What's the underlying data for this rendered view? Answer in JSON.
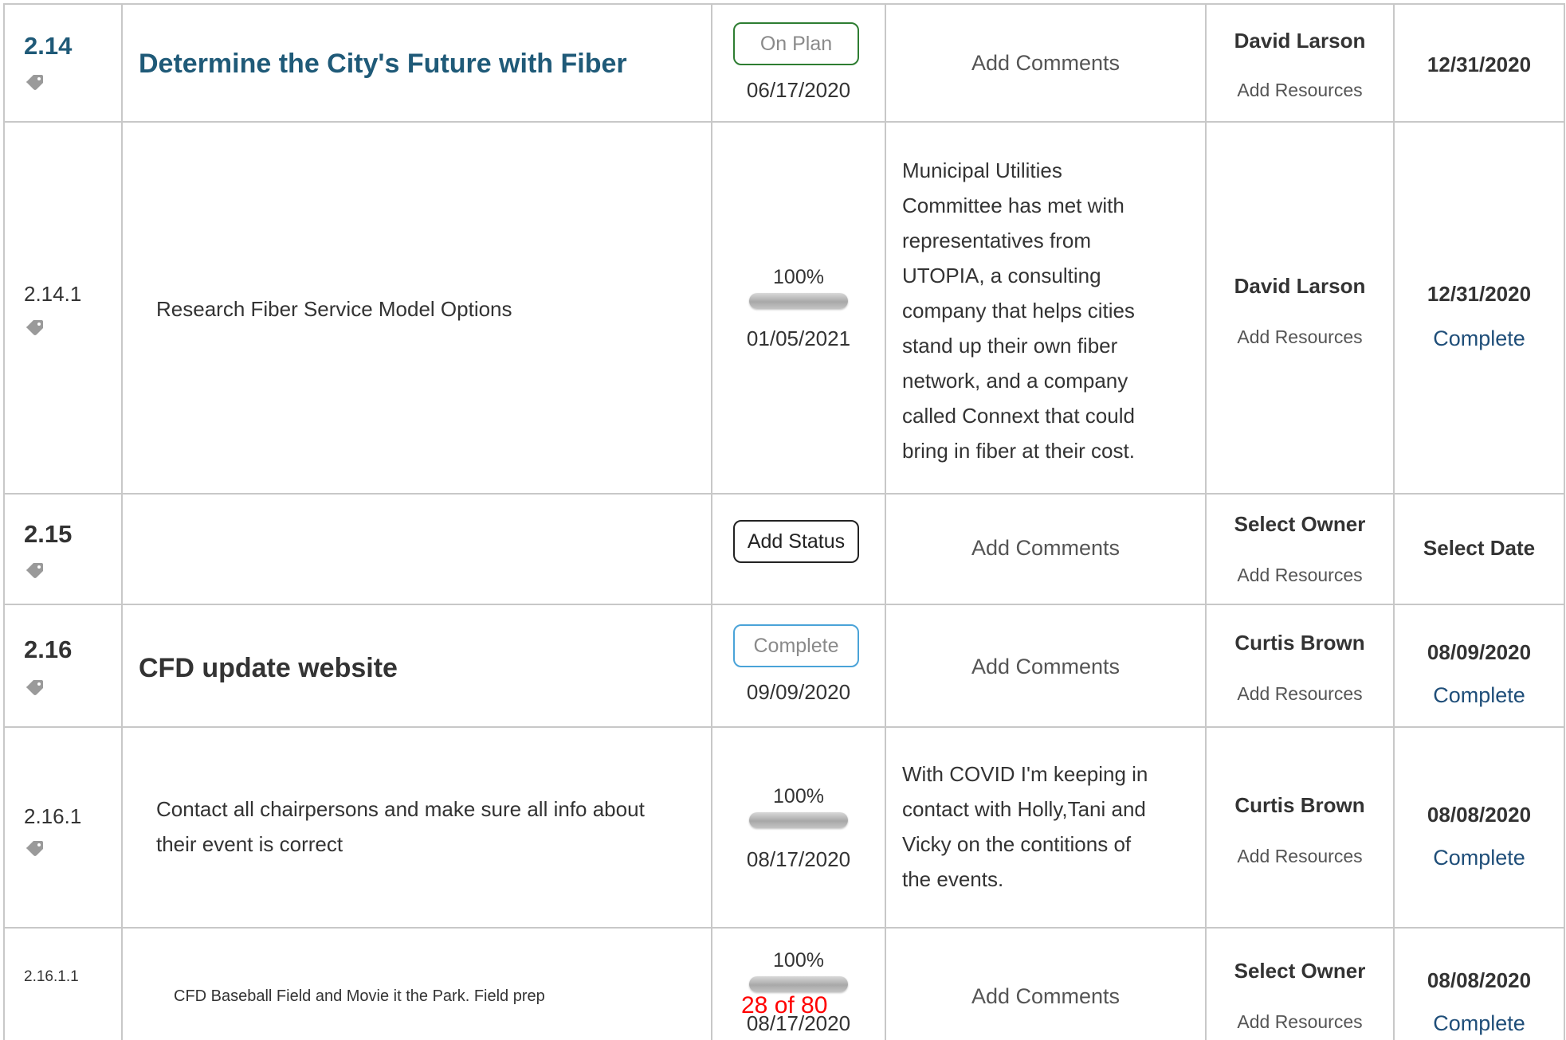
{
  "colors": {
    "link_blue": "#1f5a78",
    "on_plan_green": "#2e7d32",
    "complete_blue": "#4aa3d8",
    "page_indicator_red": "#ff0000"
  },
  "rows": [
    {
      "number": "2.14",
      "title": "Determine the City's Future with Fiber",
      "status": "On Plan",
      "status_date": "06/17/2020",
      "comments": "Add Comments",
      "owner": "David Larson",
      "resources": "Add Resources",
      "due_date": "12/31/2020"
    },
    {
      "number": "2.14.1",
      "title": "Research Fiber Service Model Options",
      "progress_label": "100%",
      "progress": 1.0,
      "status_date": "01/05/2021",
      "comment_lines": [
        "Municipal Utilities",
        "Committee has met with",
        "representatives from",
        "UTOPIA, a consulting",
        "company that helps cities",
        "stand up their own fiber",
        "network, and a company",
        "called Connext that could",
        "bring in fiber at their cost."
      ],
      "owner": "David Larson",
      "resources": "Add Resources",
      "due_date": "12/31/2020",
      "completion": "Complete"
    },
    {
      "number": "2.15",
      "title": "",
      "status": "Add Status",
      "comments": "Add Comments",
      "owner": "Select Owner",
      "resources": "Add Resources",
      "due_date": "Select Date"
    },
    {
      "number": "2.16",
      "title": "CFD update website",
      "status": "Complete",
      "status_date": "09/09/2020",
      "comments": "Add Comments",
      "owner": "Curtis Brown",
      "resources": "Add Resources",
      "due_date": "08/09/2020",
      "completion": "Complete"
    },
    {
      "number": "2.16.1",
      "title_lines": [
        "Contact all chairpersons and make sure all info about",
        "their event is correct"
      ],
      "progress_label": "100%",
      "progress": 1.0,
      "status_date": "08/17/2020",
      "comment_lines": [
        "With COVID I'm keeping in",
        "contact with Holly,Tani and",
        "Vicky on the contitions of",
        "the events."
      ],
      "owner": "Curtis Brown",
      "resources": "Add Resources",
      "due_date": "08/08/2020",
      "completion": "Complete"
    },
    {
      "number": "2.16.1.1",
      "title": "CFD Baseball Field and Movie it the Park. Field prep",
      "progress_label": "100%",
      "progress": 1.0,
      "status_date": "08/17/2020",
      "comments": "Add Comments",
      "owner": "Select Owner",
      "resources": "Add Resources",
      "due_date": "08/08/2020",
      "completion": "Complete"
    }
  ],
  "page_indicator": "28 of 80",
  "icons": [
    "tag-icon"
  ]
}
